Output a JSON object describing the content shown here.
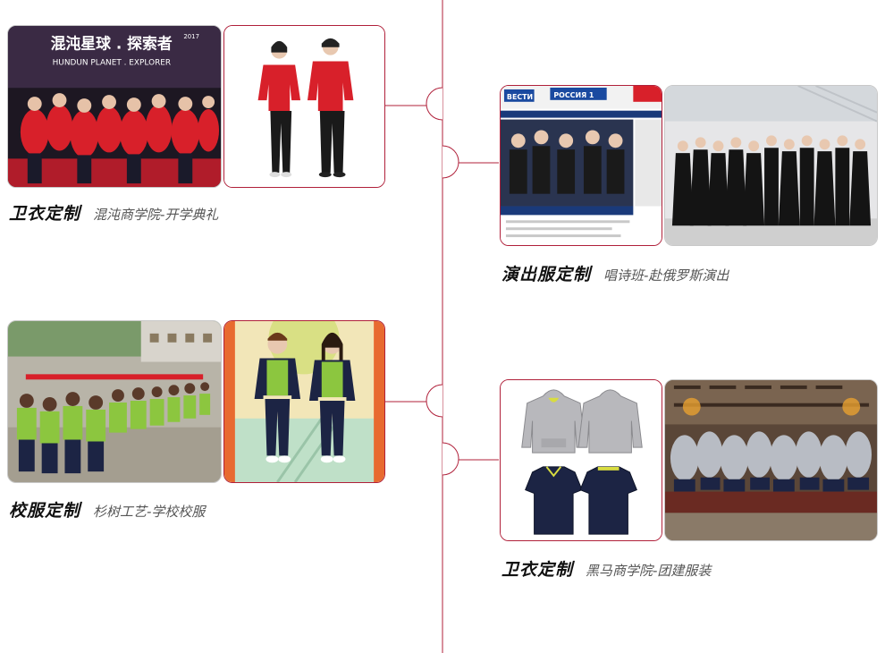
{
  "colors": {
    "accent": "#b0203a",
    "line": "#b0203a",
    "title_text": "#111111",
    "subtitle_text": "#555555",
    "red_uniform": "#d8202a",
    "green_uniform": "#8cc63f",
    "navy_uniform": "#1c2444"
  },
  "entries": [
    {
      "title": "卫衣定制",
      "subtitle": "混沌商学院-开学典礼",
      "banner_cn": "混沌星球 . 探索者",
      "banner_en": "HUNDUN PLANET . EXPLORER",
      "banner_year": "2017"
    },
    {
      "title": "演出服定制",
      "subtitle": "唱诗班-赴俄罗斯演出",
      "tv_brand": "ВЕСТИ",
      "tv_channel": "РОССИЯ 1"
    },
    {
      "title": "校服定制",
      "subtitle": "杉树工艺-学校校服"
    },
    {
      "title": "卫衣定制",
      "subtitle": "黑马商学院-团建服装"
    }
  ]
}
